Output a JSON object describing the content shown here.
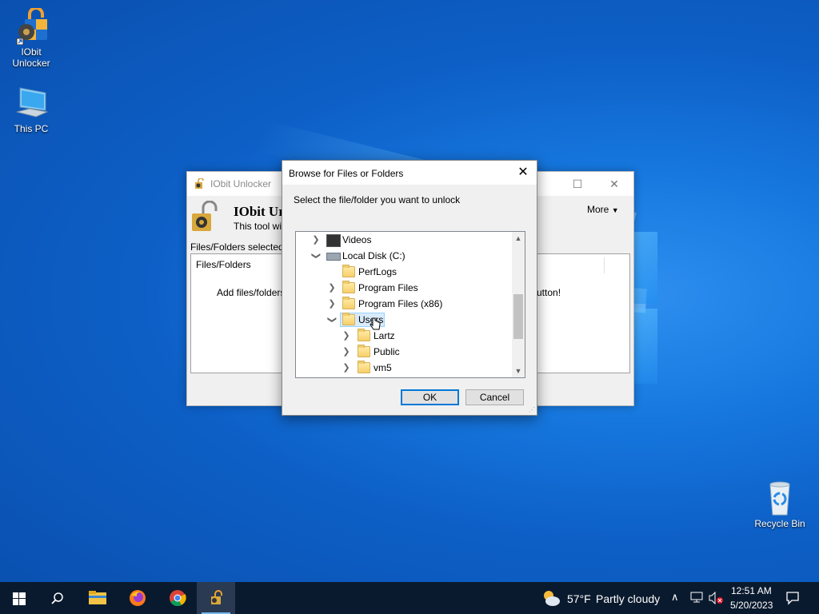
{
  "desktop": {
    "icons": [
      {
        "label": "IObit\nUnlocker",
        "line1": "IObit",
        "line2": "Unlocker"
      },
      {
        "label": "This PC"
      },
      {
        "label": "Recycle Bin"
      }
    ]
  },
  "app_window": {
    "title": "IObit Unlocker",
    "heading": "IObit Ur",
    "subtitle": "This tool will l",
    "more_label": "More",
    "section_label": "Files/Folders selected",
    "column_header": "Files/Folders",
    "hint_left": "Add files/folders t",
    "hint_right": "utton!"
  },
  "dialog": {
    "title": "Browse for Files or Folders",
    "prompt": "Select the file/folder you want to unlock",
    "tree": [
      {
        "label": "Videos",
        "expander": "collapsed"
      },
      {
        "label": "Local Disk (C:)",
        "expander": "expanded"
      },
      {
        "label": "PerfLogs",
        "expander": "none"
      },
      {
        "label": "Program Files",
        "expander": "collapsed"
      },
      {
        "label": "Program Files (x86)",
        "expander": "collapsed"
      },
      {
        "label": "Users",
        "expander": "expanded",
        "selected": true
      },
      {
        "label": "Lartz",
        "expander": "collapsed"
      },
      {
        "label": "Public",
        "expander": "collapsed"
      },
      {
        "label": "vm5",
        "expander": "collapsed"
      }
    ],
    "ok_label": "OK",
    "cancel_label": "Cancel"
  },
  "taskbar": {
    "weather_temp": "57°F",
    "weather_desc": "Partly cloudy",
    "time": "12:51 AM",
    "date": "5/20/2023"
  },
  "colors": {
    "accent": "#0078d7",
    "selection_bg": "#d9ebfa",
    "taskbar_bg": "#0a1a2e"
  }
}
